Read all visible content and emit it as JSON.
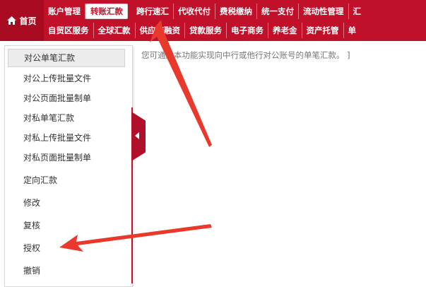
{
  "nav": {
    "home_label": "首页",
    "row1": [
      "账户管理",
      "转账汇款",
      "跨行速汇",
      "代收代付",
      "费税缴纳",
      "统一支付",
      "流动性管理",
      "汇"
    ],
    "row1_active": "转账汇款",
    "row2": [
      "自贸区服务",
      "全球汇款",
      "供应链融资",
      "贷款服务",
      "电子商务",
      "养老金",
      "资产托管",
      "单"
    ]
  },
  "notice": "您可通过本功能实现向中行或他行对公账号的单笔汇款。 ]",
  "menu": {
    "active": "对公单笔汇款",
    "items": [
      "对公上传批量文件",
      "对公页面批量制单",
      "对私单笔汇款",
      "对私上传批量文件",
      "对私页面批量制单",
      "定向汇款",
      "修改",
      "复核",
      "授权",
      "撤销"
    ]
  },
  "colors": {
    "brand": "#c0102a",
    "arrow": "#e8392c"
  },
  "icons": {
    "home": "home-icon",
    "collapse": "chevron-left-icon"
  }
}
